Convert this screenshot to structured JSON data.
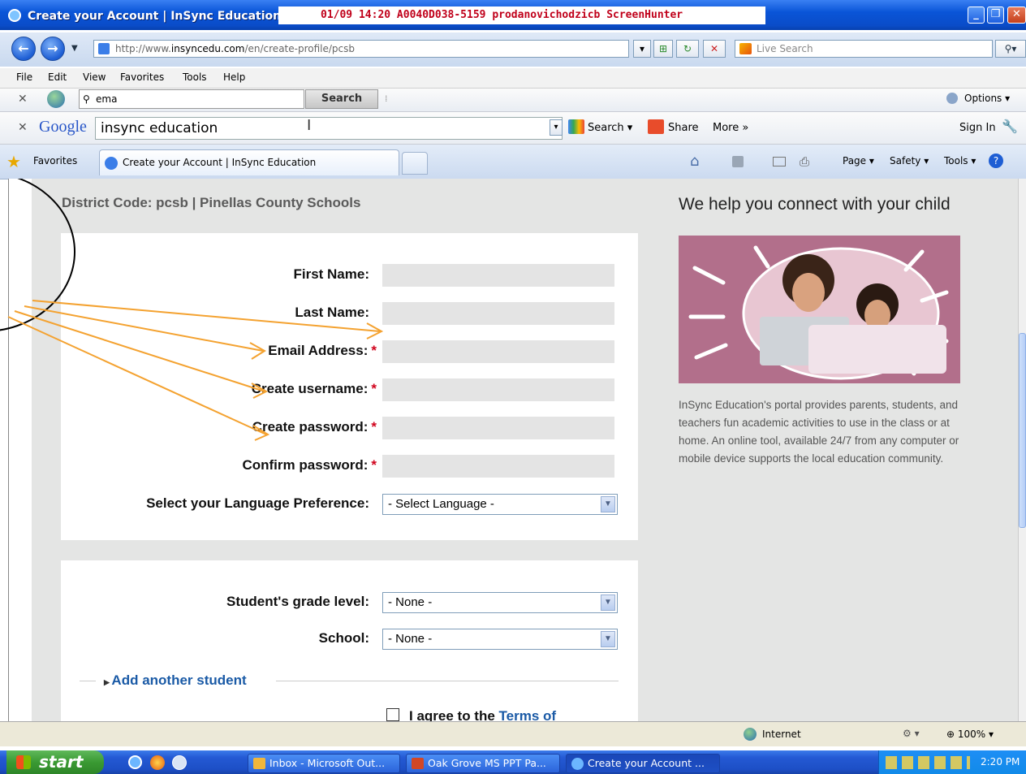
{
  "window": {
    "title": "Create your Account | InSync Education",
    "overlay_banner": "01/09  14:20  A0040D038-5159  prodanovichodzicb  ScreenHunter"
  },
  "address_bar": {
    "url_prefix": "http://www.",
    "url_domain": "insyncedu.com",
    "url_path": "/en/create-profile/pcsb",
    "live_search_placeholder": "Live Search"
  },
  "menu": [
    "File",
    "Edit",
    "View",
    "Favorites",
    "Tools",
    "Help"
  ],
  "toolbar_search": {
    "query": "ema",
    "button": "Search",
    "options": "Options"
  },
  "google_toolbar": {
    "logo": "Google",
    "query": "insync education",
    "search": "Search",
    "share": "Share",
    "more": "More »",
    "sign_in": "Sign In"
  },
  "favorites_bar": {
    "favorites": "Favorites",
    "tab_label": "Create your Account | InSync Education",
    "page": "Page",
    "safety": "Safety",
    "tools": "Tools"
  },
  "page": {
    "district": "District Code: pcsb | Pinellas County Schools",
    "form": {
      "first_name": "First Name:",
      "last_name": "Last Name:",
      "email": "Email Address:",
      "username": "Create username:",
      "password": "Create password:",
      "confirm": "Confirm password:",
      "language_label": "Select your Language Preference:",
      "language_value": "- Select Language -",
      "required_mark": "*"
    },
    "student": {
      "grade_label": "Student's grade level:",
      "grade_value": "- None -",
      "school_label": "School:",
      "school_value": "- None -",
      "add_another": "Add another student",
      "agree_prefix": "I agree to the",
      "agree_link": "Terms of"
    },
    "right": {
      "heading": "We help you connect with your child",
      "description": "InSync Education's portal provides parents, students, and teachers fun academic activities to use in the class or at home.  An online tool, available 24/7 from any computer or mobile device supports the local education community."
    }
  },
  "status_bar": {
    "zone": "Internet",
    "zoom": "100%"
  },
  "taskbar": {
    "start": "start",
    "tasks": [
      "Inbox - Microsoft Out...",
      "Oak Grove MS PPT Pa...",
      "Create your Account ..."
    ],
    "clock": "2:20 PM"
  }
}
